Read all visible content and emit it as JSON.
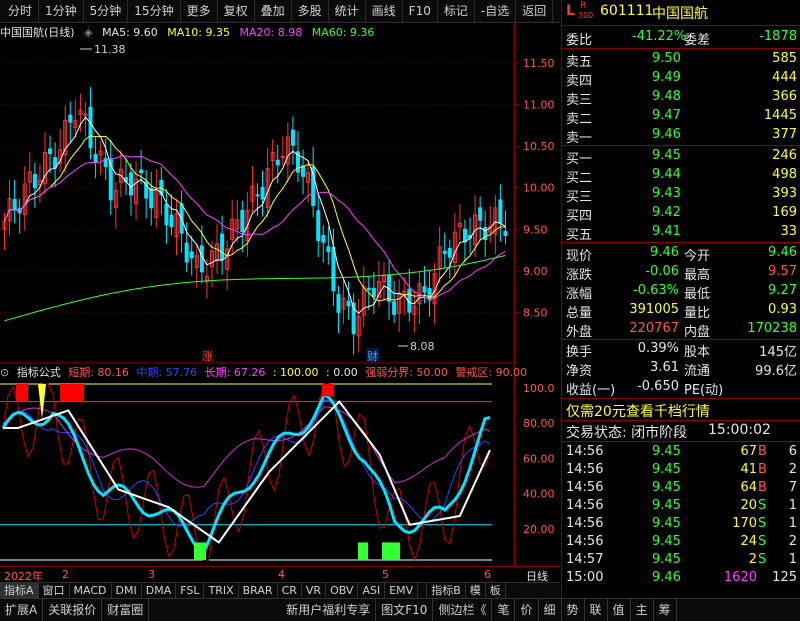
{
  "toolbar": {
    "items": [
      "分时",
      "1分钟",
      "5分钟",
      "15分钟",
      "更多",
      "复权",
      "叠加",
      "多股",
      "统计",
      "画线",
      "F10",
      "标记",
      "-自选",
      "返回"
    ]
  },
  "header": {
    "name": "中国国航(日线)",
    "ma5": "MA5: 9.60",
    "ma10": "MA10: 9.35",
    "ma20": "MA20: 8.98",
    "ma60": "MA60: 9.36"
  },
  "price_axis": {
    "labels": [
      "11.50",
      "11.00",
      "10.50",
      "10.00",
      "9.50",
      "9.00",
      "8.50"
    ]
  },
  "annotations": {
    "high": "11.38",
    "low": "8.08",
    "zhang": "涨",
    "cai": "财"
  },
  "indicator": {
    "title": "指标公式",
    "short": "短期: 80.16",
    "mid": "中期: 57.76",
    "long": "长期: 67.26",
    "c100": ": 100.00",
    "c0": ": 0.00",
    "strong": "强弱分界: 50.00",
    "warn": "警戒区: 90.00",
    "axis": [
      "100.0",
      "80.00",
      "60.00",
      "40.00",
      "20.00"
    ]
  },
  "timebar": {
    "year": "2022年",
    "m2": "2",
    "m3": "3",
    "m4": "4",
    "m5": "5",
    "m6": "6",
    "right": "日线"
  },
  "tabs": [
    "指标A",
    "窗口",
    "MACD",
    "DMI",
    "DMA",
    "FSL",
    "TRIX",
    "BRAR",
    "CR",
    "VR",
    "OBV",
    "ASI",
    "EMV",
    "",
    "指标B",
    "模",
    "板"
  ],
  "quote": {
    "badge_l": "L",
    "badge_r": "R",
    "badge_n": "300",
    "code": "601111",
    "name": "中国国航",
    "wb_label": "委比",
    "wb_value": "-41.22%",
    "wc_label": "委差",
    "wc_value": "-1878",
    "asks": [
      {
        "l": "卖五",
        "p": "9.50",
        "v": "585"
      },
      {
        "l": "卖四",
        "p": "9.49",
        "v": "444"
      },
      {
        "l": "卖三",
        "p": "9.48",
        "v": "366"
      },
      {
        "l": "卖二",
        "p": "9.47",
        "v": "1445"
      },
      {
        "l": "卖一",
        "p": "9.46",
        "v": "377"
      }
    ],
    "bids": [
      {
        "l": "买一",
        "p": "9.45",
        "v": "246"
      },
      {
        "l": "买二",
        "p": "9.44",
        "v": "498"
      },
      {
        "l": "买三",
        "p": "9.43",
        "v": "393"
      },
      {
        "l": "买四",
        "p": "9.42",
        "v": "169"
      },
      {
        "l": "买五",
        "p": "9.41",
        "v": "33"
      }
    ],
    "stats": [
      {
        "l1": "现价",
        "v1": "9.46",
        "l2": "今开",
        "v2": "9.46"
      },
      {
        "l1": "涨跌",
        "v1": "-0.06",
        "l2": "最高",
        "v2": "9.57"
      },
      {
        "l1": "涨幅",
        "v1": "-0.63%",
        "l2": "最低",
        "v2": "9.27"
      },
      {
        "l1": "总量",
        "v1": "391005",
        "l2": "量比",
        "v2": "0.93"
      },
      {
        "l1": "外盘",
        "v1": "220767",
        "l2": "内盘",
        "v2": "170238"
      }
    ],
    "stats2": [
      {
        "l1": "换手",
        "v1": "0.39%",
        "l2": "股本",
        "v2": "145亿"
      },
      {
        "l1": "净资",
        "v1": "3.61",
        "l2": "流通",
        "v2": "99.6亿"
      },
      {
        "l1": "收益(一)",
        "v1": "-0.650",
        "l2": "PE(动)",
        "v2": ""
      }
    ],
    "promo": "仅需20元查看千档行情",
    "status_label": "交易状态: 闭市阶段",
    "status_time": "15:00:02",
    "ticks": [
      {
        "t": "14:56",
        "p": "9.45",
        "v": "67",
        "s": "B",
        "n": "6"
      },
      {
        "t": "14:56",
        "p": "9.45",
        "v": "41",
        "s": "B",
        "n": "2"
      },
      {
        "t": "14:56",
        "p": "9.45",
        "v": "64",
        "s": "B",
        "n": "7"
      },
      {
        "t": "14:56",
        "p": "9.45",
        "v": "20",
        "s": "S",
        "n": "1"
      },
      {
        "t": "14:56",
        "p": "9.45",
        "v": "170",
        "s": "S",
        "n": "1"
      },
      {
        "t": "14:56",
        "p": "9.45",
        "v": "24",
        "s": "S",
        "n": "2"
      },
      {
        "t": "14:57",
        "p": "9.45",
        "v": "2",
        "s": "S",
        "n": "1"
      },
      {
        "t": "15:00",
        "p": "9.46",
        "v": "1620",
        "s": "",
        "n": "125"
      }
    ]
  },
  "bottombar": {
    "left": [
      "扩展A",
      "关联报价",
      "财富圈"
    ],
    "mid": "新用户福利专享",
    "f10": "图文F10",
    "side": "侧边栏《",
    "right": [
      "笔",
      "价",
      "细",
      "势",
      "联",
      "值",
      "主",
      "筹"
    ]
  },
  "colors": {
    "up": "#ff3333",
    "down": "#00e5ff",
    "ma5": "#ffffff",
    "ma10": "#ffff33",
    "ma20": "#ff40ff",
    "ma60": "#33ff33"
  }
}
